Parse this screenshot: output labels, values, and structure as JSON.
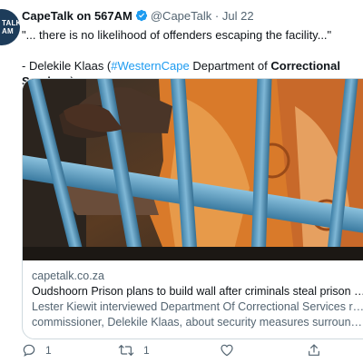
{
  "tweet": {
    "author_name": "CapeTalk on 567AM",
    "handle": "@CapeTalk",
    "separator": "·",
    "date": "Jul 22",
    "avatar_text_line1": "TALK",
    "avatar_text_line2": "AM",
    "text_line1": "\"... there is no likelihood of offenders escaping the facility...\"",
    "text_line2_prefix": "- Delekile Klaas (",
    "text_hashtag": "#WesternCape",
    "text_line2_middle": " Department of ",
    "text_bold": "Correctional Services",
    "text_line2_suffix": ")"
  },
  "card": {
    "image_name": "prison-bars-photo",
    "domain": "capetalk.co.za",
    "title": "Oudshoorn Prison plans to build wall after criminals steal prison fenc...",
    "description_line1": "Lester Kiewit interviewed Department Of Correctional Services regional",
    "description_line2": "commissioner, Delekile Klaas, about security measures surrounding th..."
  },
  "actions": {
    "reply_count": "1",
    "retweet_count": "1",
    "like_count": "",
    "share_count": ""
  },
  "colors": {
    "accent": "#1d9bf0",
    "secondary_text": "#536471",
    "border": "#cfd9de"
  }
}
